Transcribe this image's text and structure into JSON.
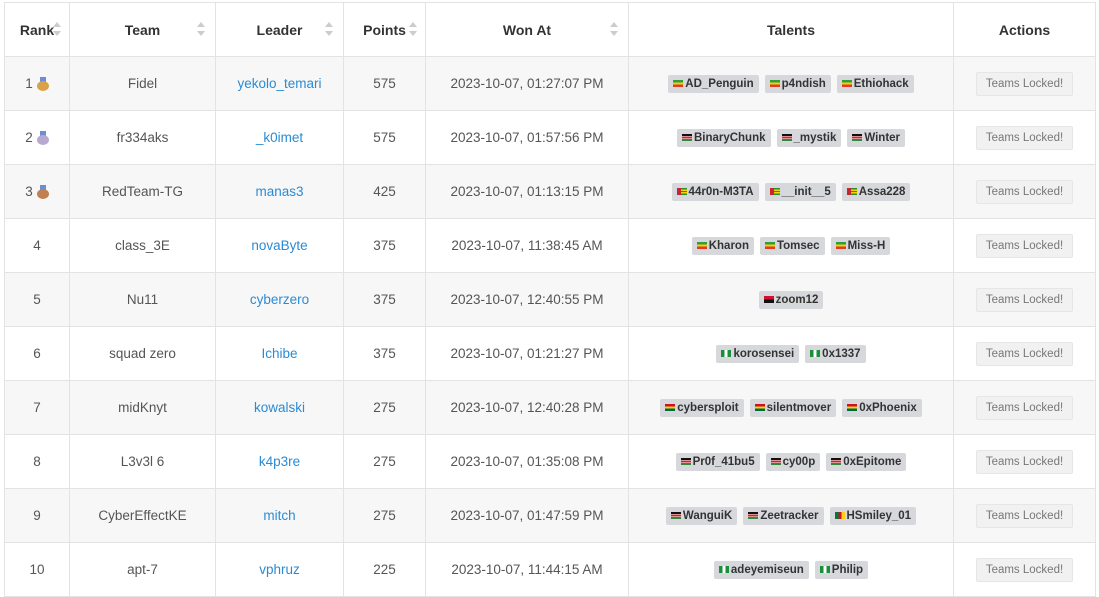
{
  "headers": {
    "rank": "Rank",
    "team": "Team",
    "leader": "Leader",
    "points": "Points",
    "won_at": "Won At",
    "talents": "Talents",
    "actions": "Actions"
  },
  "action_label": "Teams Locked!",
  "medal_colors": {
    "gold": "#d9a14a",
    "silver": "#b9a9cf",
    "bronze": "#c0804f"
  },
  "flag_colors": {
    "ET": "linear-gradient(#2e9e44 0 33%, #f1d400 33% 66%, #e23a2e 66%)",
    "KE": "linear-gradient(#111 0 30%, #fff 30% 36%, #c6262e 36% 64%, #fff 64% 70%, #2e8b3c 70%)",
    "TG": "linear-gradient(90deg, #c6262e 0 40%, transparent 40%), repeating-linear-gradient(#2e8b3c 0 20%, #f1d400 20% 40%)",
    "AO": "linear-gradient(#d21034 0 50%, #111 50%)",
    "NG": "linear-gradient(90deg, #1c8f3d 0 33%, #fff 33% 66%, #1c8f3d 66%)",
    "GH": "linear-gradient(#ce1126 0 33%, #fcd116 33% 66%, #006b3f 66%)",
    "CM": "linear-gradient(90deg, #007a3d 0 33%, #ce1126 33% 66%, #fcd116 66%)"
  },
  "rows": [
    {
      "rank": "1",
      "medal": "gold",
      "team": "Fidel",
      "leader": "yekolo_temari",
      "points": "575",
      "won_at": "2023-10-07, 01:27:07 PM",
      "talents": [
        {
          "name": "AD_Penguin",
          "flag": "ET"
        },
        {
          "name": "p4ndish",
          "flag": "ET"
        },
        {
          "name": "Ethiohack",
          "flag": "ET"
        }
      ]
    },
    {
      "rank": "2",
      "medal": "silver",
      "team": "fr334aks",
      "leader": "_k0imet",
      "points": "575",
      "won_at": "2023-10-07, 01:57:56 PM",
      "talents": [
        {
          "name": "BinaryChunk",
          "flag": "KE"
        },
        {
          "name": "_mystik",
          "flag": "KE"
        },
        {
          "name": "Winter",
          "flag": "KE"
        }
      ]
    },
    {
      "rank": "3",
      "medal": "bronze",
      "team": "RedTeam-TG",
      "leader": "manas3",
      "points": "425",
      "won_at": "2023-10-07, 01:13:15 PM",
      "talents": [
        {
          "name": "44r0n-M3TA",
          "flag": "TG"
        },
        {
          "name": "__init__5",
          "flag": "TG"
        },
        {
          "name": "Assa228",
          "flag": "TG"
        }
      ]
    },
    {
      "rank": "4",
      "medal": "",
      "team": "class_3E",
      "leader": "novaByte",
      "points": "375",
      "won_at": "2023-10-07, 11:38:45 AM",
      "talents": [
        {
          "name": "Kharon",
          "flag": "ET"
        },
        {
          "name": "Tomsec",
          "flag": "ET"
        },
        {
          "name": "Miss-H",
          "flag": "ET"
        }
      ]
    },
    {
      "rank": "5",
      "medal": "",
      "team": "Nu11",
      "leader": "cyberzero",
      "points": "375",
      "won_at": "2023-10-07, 12:40:55 PM",
      "talents": [
        {
          "name": "zoom12",
          "flag": "AO"
        }
      ]
    },
    {
      "rank": "6",
      "medal": "",
      "team": "squad zero",
      "leader": "Ichibe",
      "points": "375",
      "won_at": "2023-10-07, 01:21:27 PM",
      "talents": [
        {
          "name": "korosensei",
          "flag": "NG"
        },
        {
          "name": "0x1337",
          "flag": "NG"
        }
      ]
    },
    {
      "rank": "7",
      "medal": "",
      "team": "midKnyt",
      "leader": "kowalski",
      "points": "275",
      "won_at": "2023-10-07, 12:40:28 PM",
      "talents": [
        {
          "name": "cybersploit",
          "flag": "GH"
        },
        {
          "name": "silentmover",
          "flag": "GH"
        },
        {
          "name": "0xPhoenix",
          "flag": "GH"
        }
      ]
    },
    {
      "rank": "8",
      "medal": "",
      "team": "L3v3l 6",
      "leader": "k4p3re",
      "points": "275",
      "won_at": "2023-10-07, 01:35:08 PM",
      "talents": [
        {
          "name": "Pr0f_41bu5",
          "flag": "KE"
        },
        {
          "name": "cy00p",
          "flag": "KE"
        },
        {
          "name": "0xEpitome",
          "flag": "KE"
        }
      ]
    },
    {
      "rank": "9",
      "medal": "",
      "team": "CyberEffectKE",
      "leader": "mitch",
      "points": "275",
      "won_at": "2023-10-07, 01:47:59 PM",
      "talents": [
        {
          "name": "WanguiK",
          "flag": "KE"
        },
        {
          "name": "Zeetracker",
          "flag": "KE"
        },
        {
          "name": "HSmiley_01",
          "flag": "CM"
        }
      ]
    },
    {
      "rank": "10",
      "medal": "",
      "team": "apt-7",
      "leader": "vphruz",
      "points": "225",
      "won_at": "2023-10-07, 11:44:15 AM",
      "talents": [
        {
          "name": "adeyemiseun",
          "flag": "NG"
        },
        {
          "name": "Philip",
          "flag": "NG"
        }
      ]
    }
  ]
}
